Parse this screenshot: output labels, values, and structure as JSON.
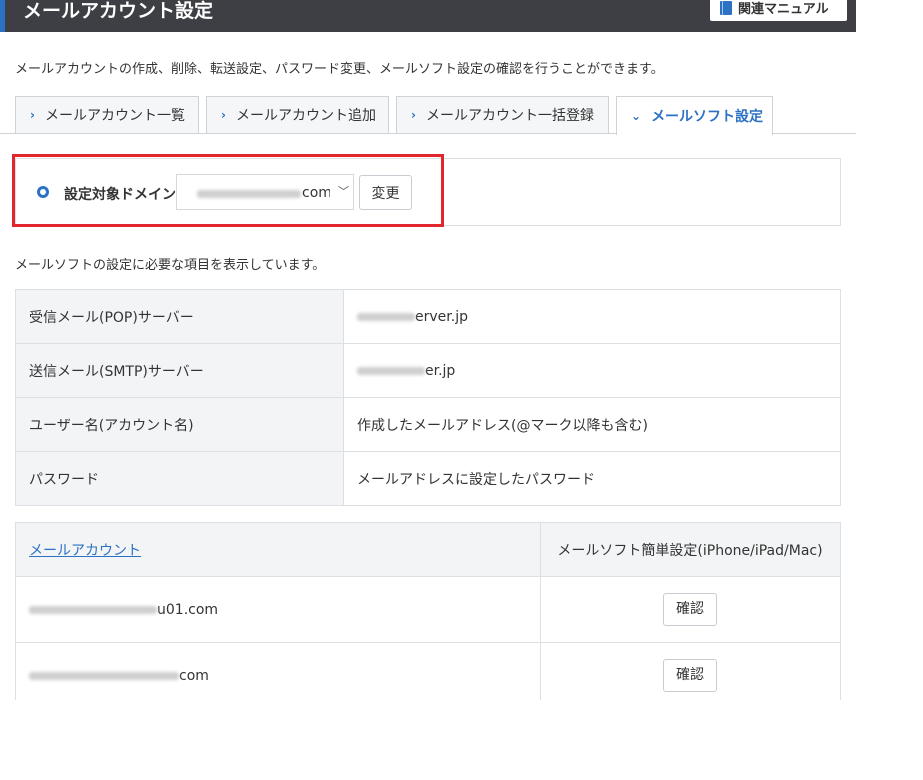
{
  "header": {
    "title": "メールアカウント設定",
    "manual_label": "関連マニュアル"
  },
  "description": "メールアカウントの作成、削除、転送設定、パスワード変更、メールソフト設定の確認を行うことができます。",
  "tabs": [
    {
      "label": "メールアカウント一覧",
      "active": false
    },
    {
      "label": "メールアカウント追加",
      "active": false
    },
    {
      "label": "メールアカウント一括登録",
      "active": false
    },
    {
      "label": "メールソフト設定",
      "active": true
    }
  ],
  "domain": {
    "label": "設定対象ドメイン",
    "selected_suffix": "com",
    "change_label": "変更"
  },
  "settings_intro": "メールソフトの設定に必要な項目を表示しています。",
  "settings": [
    {
      "key": "受信メール(POP)サーバー",
      "value": "erver.jp"
    },
    {
      "key": "送信メール(SMTP)サーバー",
      "value": "er.jp"
    },
    {
      "key": "ユーザー名(アカウント名)",
      "value": "作成したメールアドレス(@マーク以降も含む)"
    },
    {
      "key": "パスワード",
      "value": "メールアドレスに設定したパスワード"
    }
  ],
  "accounts_table": {
    "col_account": "メールアカウント",
    "col_setup": "メールソフト簡単設定(iPhone/iPad/Mac)",
    "rows": [
      {
        "account": "u01.com",
        "button": "確認"
      },
      {
        "account": "com",
        "button": "確認"
      }
    ]
  },
  "colors": {
    "accent": "#2b71c4",
    "header_bg": "#3d3f44",
    "highlight": "#e3262d"
  }
}
